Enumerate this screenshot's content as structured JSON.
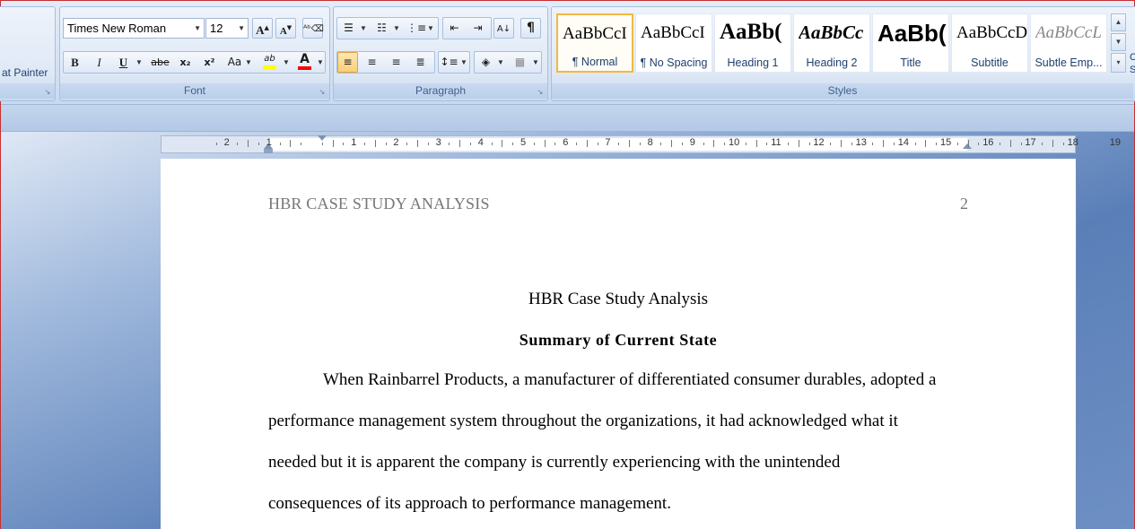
{
  "clipboard": {
    "format_painter_label": "at Painter"
  },
  "font": {
    "group_label": "Font",
    "family": "Times New Roman",
    "size": "12",
    "grow_label": "A",
    "shrink_label": "A",
    "bold_label": "B",
    "italic_label": "I",
    "underline_label": "U",
    "strike_label": "abe",
    "subscript_label": "x₂",
    "superscript_label": "x²",
    "change_case_label": "Aa",
    "highlight_label": "ab",
    "font_color_label": "A"
  },
  "paragraph": {
    "group_label": "Paragraph",
    "show_marks_label": "¶"
  },
  "styles": {
    "group_label": "Styles",
    "items": [
      {
        "sample": "AaBbCcI",
        "name": "¶ Normal"
      },
      {
        "sample": "AaBbCcI",
        "name": "¶ No Spacing"
      },
      {
        "sample": "AaBb(",
        "name": "Heading 1"
      },
      {
        "sample": "AaBbCc",
        "name": "Heading 2"
      },
      {
        "sample": "AaBb(",
        "name": "Title"
      },
      {
        "sample": "AaBbCcD",
        "name": "Subtitle"
      },
      {
        "sample": "AaBbCcL",
        "name": "Subtle Emp..."
      }
    ],
    "partial_next": "C S"
  },
  "ruler": {
    "numbers": [
      "2",
      "1",
      "1",
      "2",
      "3",
      "4",
      "5",
      "6",
      "7",
      "8",
      "9",
      "10",
      "11",
      "12",
      "13",
      "14",
      "15",
      "16",
      "17",
      "18",
      "19"
    ]
  },
  "document": {
    "header_left": "HBR CASE STUDY ANALYSIS",
    "page_number": "2",
    "title": "HBR Case Study Analysis",
    "heading": "Summary of Current State",
    "lines": [
      "When Rainbarrel Products, a manufacturer of differentiated consumer durables, adopted a",
      "performance management system throughout the organizations, it had acknowledged what it",
      "needed but it is apparent the company is currently experiencing with the unintended",
      "consequences of its approach to performance management."
    ]
  },
  "colors": {
    "accent_selected": "#f2b844",
    "highlight_yellow": "#ffff00",
    "font_color_red": "#ff0000"
  }
}
